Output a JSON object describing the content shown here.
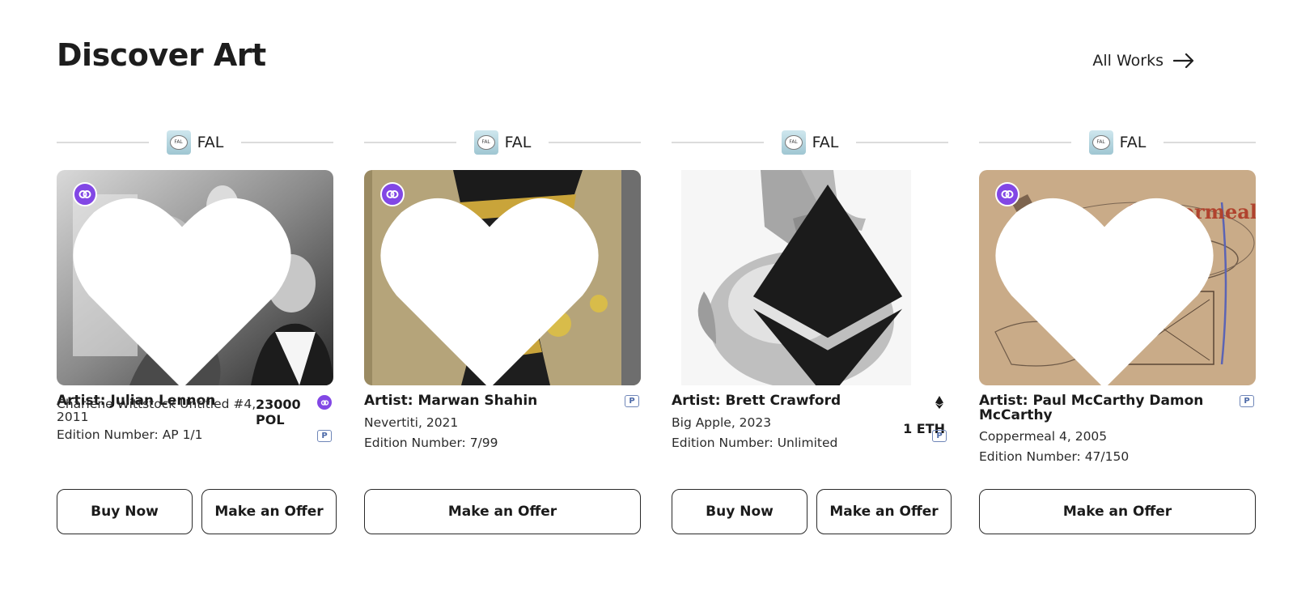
{
  "header": {
    "title": "Discover Art",
    "all_works_label": "All Works"
  },
  "cards": [
    {
      "gallery": "FAL",
      "chain": "polygon",
      "artist": "Artist: Julian Lennon",
      "work": "Charlene Wittstock Untitled #4, 2011",
      "edition": "Edition Number: AP 1/1",
      "price_amount": "23000",
      "price_currency": "POL",
      "buy_label": "Buy Now",
      "offer_label": "Make an Offer"
    },
    {
      "gallery": "FAL",
      "chain": "polygon",
      "artist": "Artist: Marwan Shahin",
      "work": "Nevertiti, 2021",
      "edition": "Edition Number: 7/99",
      "offer_label": "Make an Offer"
    },
    {
      "gallery": "FAL",
      "chain": "ethereum",
      "artist": "Artist: Brett Crawford",
      "work": "Big Apple, 2023",
      "edition": "Edition Number: Unlimited",
      "price": "1 ETH",
      "buy_label": "Buy Now",
      "offer_label": "Make an Offer"
    },
    {
      "gallery": "FAL",
      "chain": "polygon",
      "artist": "Artist: Paul McCarthy Damon McCarthy",
      "work": "Coppermeal 4, 2005",
      "edition": "Edition Number: 47/150",
      "art_text": "Coppermeal",
      "offer_label": "Make an Offer"
    }
  ],
  "icons": {
    "arrow": "arrow-right-icon",
    "heart": "heart-icon",
    "polygon": "polygon-icon",
    "ethereum": "ethereum-icon",
    "p_badge": "p-badge-icon"
  },
  "colors": {
    "polygon_purple": "#8247e5",
    "p_badge_blue": "#4d6aa8",
    "text_dark": "#1b1b1b"
  }
}
